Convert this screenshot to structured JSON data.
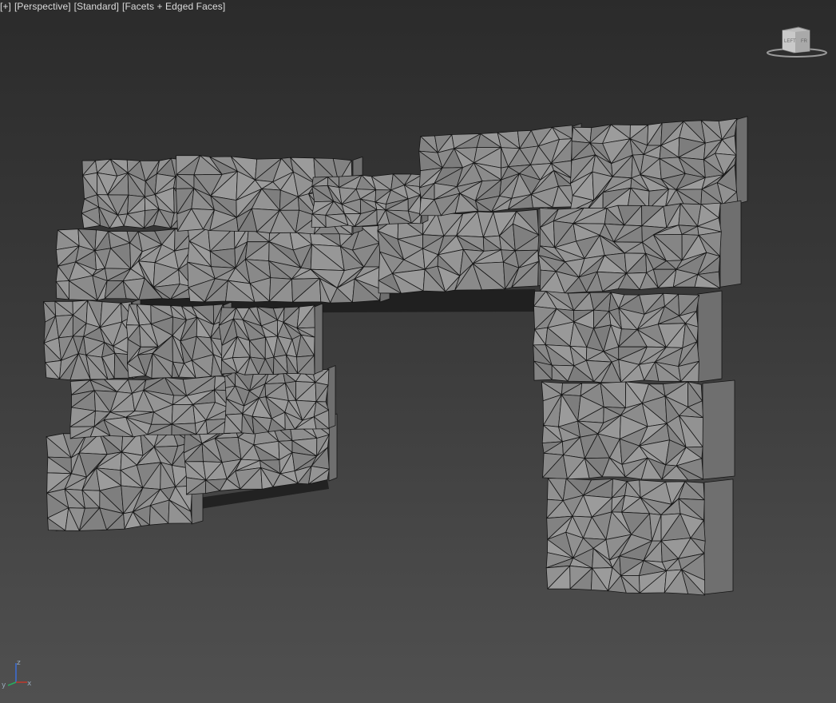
{
  "viewport": {
    "labels": [
      "[+]",
      "[Perspective]",
      "[Standard]",
      "[Facets + Edged Faces]"
    ]
  },
  "viewcube": {
    "faces": [
      "LEFT",
      "FR"
    ]
  },
  "axis": {
    "z": "z",
    "x": "x",
    "y": "y"
  },
  "colors": {
    "mesh_fill": "#8e8e8e",
    "mesh_edge": "#151515",
    "background_top": "#2b2b2b",
    "background_bottom": "#505050",
    "axis_x": "#c0392b",
    "axis_y": "#27ae60",
    "axis_z": "#3b6fd8"
  },
  "icons": [
    "viewcube-icon",
    "axis-tripod-icon"
  ]
}
